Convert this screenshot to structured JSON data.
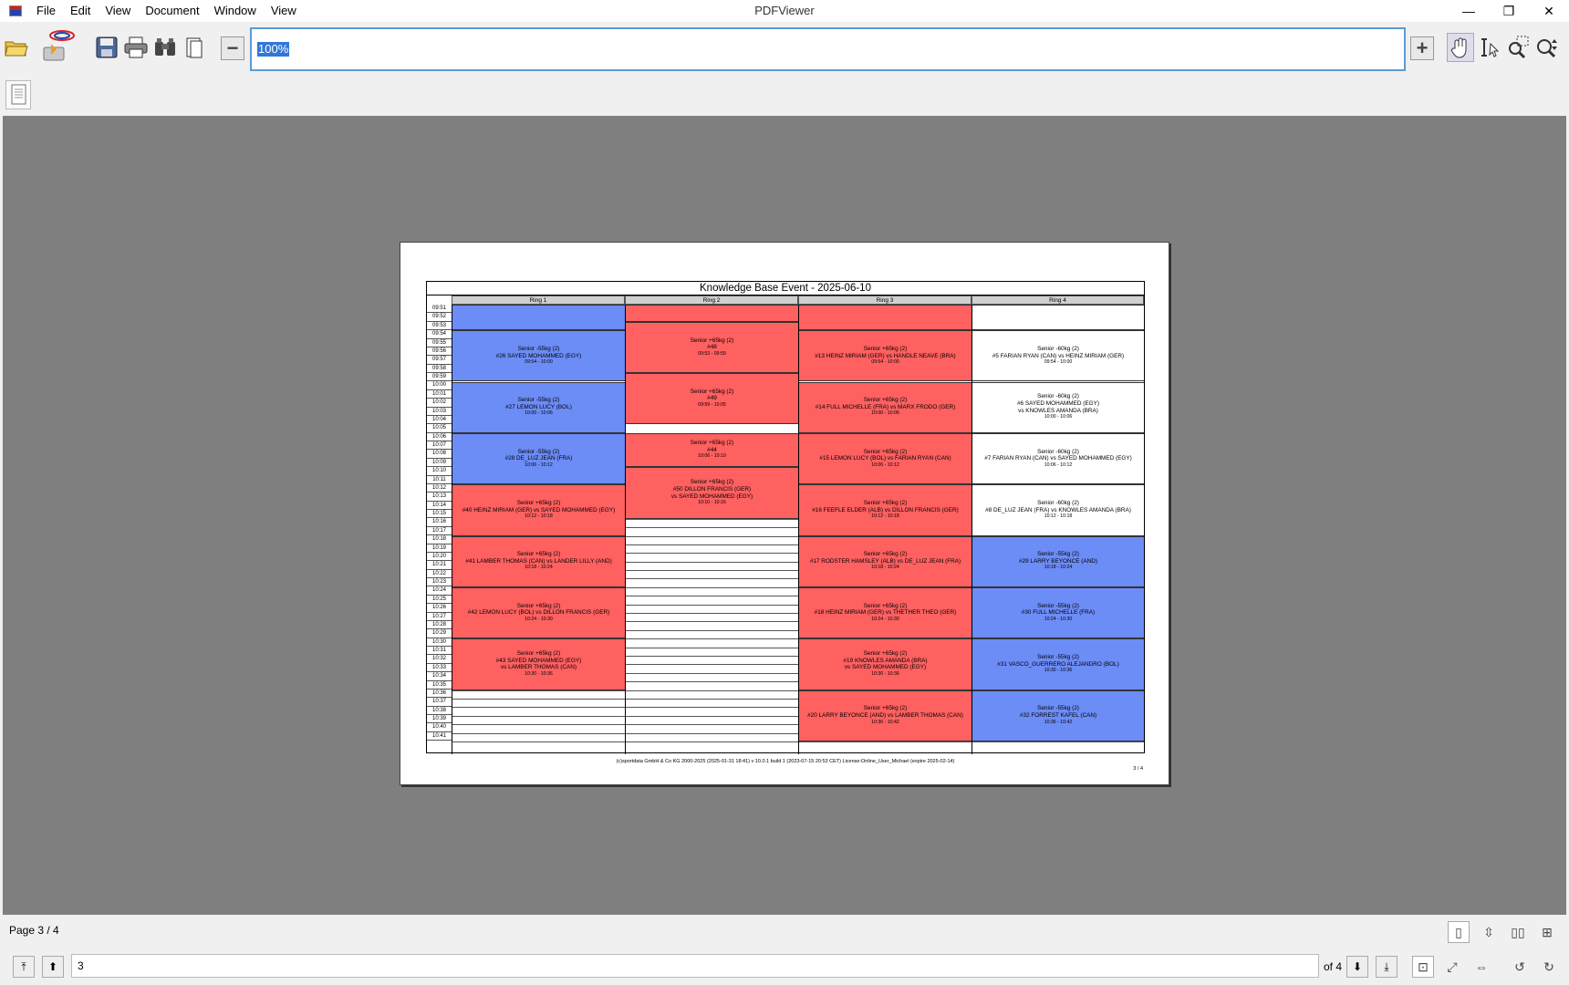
{
  "window": {
    "title": "PDFViewer",
    "minimize": "—",
    "restore": "❐",
    "close": "✕"
  },
  "menu": [
    "File",
    "Edit",
    "View",
    "Document",
    "Window",
    "View"
  ],
  "toolbar": {
    "zoom_value": "100%",
    "zoom_out": "−",
    "zoom_in": "+"
  },
  "document": {
    "title": "Knowledge Base Event - 2025-06-10",
    "rings": [
      "Ring 1",
      "Ring 2",
      "Ring 3",
      "Ring 4"
    ],
    "times": [
      "09:51",
      "09:52",
      "09:53",
      "09:54",
      "09:55",
      "09:56",
      "09:57",
      "09:58",
      "09:59",
      "10:00",
      "10:01",
      "10:02",
      "10:03",
      "10:04",
      "10:05",
      "10:06",
      "10:07",
      "10:08",
      "10:09",
      "10:10",
      "10:11",
      "10:12",
      "10:13",
      "10:14",
      "10:15",
      "10:16",
      "10:17",
      "10:18",
      "10:19",
      "10:20",
      "10:21",
      "10:22",
      "10:23",
      "10:24",
      "10:25",
      "10:26",
      "10:27",
      "10:28",
      "10:29",
      "10:30",
      "10:31",
      "10:32",
      "10:33",
      "10:34",
      "10:35",
      "10:36",
      "10:37",
      "10:38",
      "10:39",
      "10:40",
      "10:41"
    ],
    "footer": "(c)sportdata GmbH & Co KG 2000-2025 (2025-01-31 18:41) v 10.0.1 build 1 (2023-07-15 20:53 CET) License:Online_User_Michael (expire 2025-02-14)",
    "page_of": "3 / 4"
  },
  "schedule": {
    "ring1": [
      {
        "color": "blue",
        "lines": [],
        "time": ""
      },
      {
        "color": "blue",
        "lines": [
          "Senior -55kg (2)",
          "#26 SAYED MOHAMMED (EGY)"
        ],
        "time": "09:54 - 10:00"
      },
      {
        "color": "blue",
        "lines": [
          "Senior -55kg (2)",
          "#27 LEMON LUCY (BOL)"
        ],
        "time": "10:00 - 10:06"
      },
      {
        "color": "blue",
        "lines": [
          "Senior -55kg (2)",
          "#28 DE_LUZ JEAN (FRA)"
        ],
        "time": "10:06 - 10:12"
      },
      {
        "color": "red",
        "lines": [
          "Senior +65kg (2)",
          "#40 HEINZ MIRIAM (GER) vs SAYED MOHAMMED (EGY)"
        ],
        "time": "10:12 - 10:18"
      },
      {
        "color": "red",
        "lines": [
          "Senior +65kg (2)",
          "#41 LAMBER THOMAS (CAN) vs LANDER LILLY (AND)"
        ],
        "time": "10:18 - 10:24"
      },
      {
        "color": "red",
        "lines": [
          "Senior +65kg (2)",
          "#42 LEMON LUCY (BOL) vs DILLON FRANCIS (GER)"
        ],
        "time": "10:24 - 10:30"
      },
      {
        "color": "red",
        "lines": [
          "Senior +65kg (2)",
          "#43 SAYED MOHAMMED (EGY)",
          "vs LAMBER THOMAS (CAN)"
        ],
        "time": "10:30 - 10:36"
      }
    ],
    "ring2": [
      {
        "color": "red",
        "lines": [],
        "time": ""
      },
      {
        "color": "red",
        "lines": [
          "Senior +65kg (2)",
          "#48"
        ],
        "time": "09:53 - 09:59"
      },
      {
        "color": "red",
        "lines": [
          "Senior +65kg (2)",
          "#49"
        ],
        "time": "09:59 - 10:05"
      },
      {
        "color": "red",
        "lines": [
          "Senior +65kg (2)",
          "#44"
        ],
        "time": "10:06 - 10:10"
      },
      {
        "color": "red",
        "lines": [
          "Senior +65kg (2)",
          "#50 DILLON FRANCIS (GER)",
          "vs SAYED MOHAMMED (EGY)"
        ],
        "time": "10:10 - 10:16"
      }
    ],
    "ring3": [
      {
        "color": "red",
        "lines": [],
        "time": ""
      },
      {
        "color": "red",
        "lines": [
          "Senior +65kg (2)",
          "#13 HEINZ MIRIAM (GER) vs HANDLE NEAVE (BRA)"
        ],
        "time": "09:54 - 10:00"
      },
      {
        "color": "red",
        "lines": [
          "Senior +65kg (2)",
          "#14 FULL MICHELLE (FRA) vs MARX FRODO (GER)"
        ],
        "time": "10:00 - 10:06"
      },
      {
        "color": "red",
        "lines": [
          "Senior +65kg (2)",
          "#15 LEMON LUCY (BOL) vs FARIAN RYAN (CAN)"
        ],
        "time": "10:06 - 10:12"
      },
      {
        "color": "red",
        "lines": [
          "Senior +65kg (2)",
          "#16 FEEFLE ELDER (ALB) vs DILLON FRANCIS (GER)"
        ],
        "time": "10:12 - 10:18"
      },
      {
        "color": "red",
        "lines": [
          "Senior +65kg (2)",
          "#17 RODSTER HAMSLEY (ALB) vs DE_LUZ JEAN (FRA)"
        ],
        "time": "10:18 - 10:24"
      },
      {
        "color": "red",
        "lines": [
          "Senior +65kg (2)",
          "#18 HEINZ MIRIAM (GER) vs THETHER THEO (GER)"
        ],
        "time": "10:24 - 10:30"
      },
      {
        "color": "red",
        "lines": [
          "Senior +65kg (2)",
          "#19 KNOWLES AMANDA (BRA)",
          "vs SAYED MOHAMMED (EGY)"
        ],
        "time": "10:30 - 10:36"
      },
      {
        "color": "red",
        "lines": [
          "Senior +65kg (2)",
          "#20 LARRY BEYONCE (AND) vs LAMBER THOMAS (CAN)"
        ],
        "time": "10:36 - 10:42"
      }
    ],
    "ring4": [
      {
        "color": "white",
        "lines": [],
        "time": ""
      },
      {
        "color": "white",
        "lines": [
          "Senior -60kg (2)",
          "#5 FARIAN RYAN (CAN) vs HEINZ MIRIAM (GER)"
        ],
        "time": "09:54 - 10:00"
      },
      {
        "color": "white",
        "lines": [
          "Senior -60kg (2)",
          "#6 SAYED MOHAMMED (EGY)",
          "vs KNOWLES AMANDA (BRA)"
        ],
        "time": "10:00 - 10:06"
      },
      {
        "color": "white",
        "lines": [
          "Senior -60kg (2)",
          "#7 FARIAN RYAN (CAN) vs SAYED MOHAMMED (EGY)"
        ],
        "time": "10:06 - 10:12"
      },
      {
        "color": "white",
        "lines": [
          "Senior -60kg (2)",
          "#8 DE_LUZ JEAN (FRA) vs KNOWLES AMANDA (BRA)"
        ],
        "time": "10:12 - 10:18"
      },
      {
        "color": "blue",
        "lines": [
          "Senior -55kg (2)",
          "#29 LARRY BEYONCE (AND)"
        ],
        "time": "10:18 - 10:24"
      },
      {
        "color": "blue",
        "lines": [
          "Senior -55kg (2)",
          "#30 FULL MICHELLE (FRA)"
        ],
        "time": "10:24 - 10:30"
      },
      {
        "color": "blue",
        "lines": [
          "Senior -55kg (2)",
          "#31 VASCO_GUERRERO ALEJANDRO (BOL)"
        ],
        "time": "10:30 - 10:36"
      },
      {
        "color": "blue",
        "lines": [
          "Senior -55kg (2)",
          "#32 FORREST KAFEL (CAN)"
        ],
        "time": "10:36 - 10:42"
      }
    ]
  },
  "status": {
    "page_label": "Page 3 / 4",
    "page_input": "3",
    "of_label": "of 4"
  },
  "colors": {
    "blue": "#6c8cf6",
    "red": "#ff6060",
    "viewer_bg": "#7f7f7f"
  }
}
